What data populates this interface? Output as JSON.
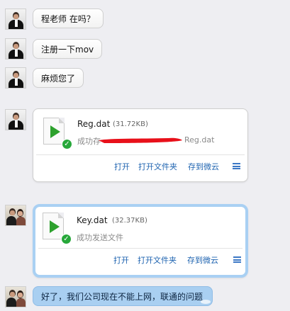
{
  "messages": [
    {
      "text": "程老师 在吗？"
    },
    {
      "text": "注册一下mov"
    },
    {
      "text": "麻烦您了"
    }
  ],
  "file_cards": [
    {
      "name": "Reg.dat",
      "size": "(31.72KB)",
      "status": "成功存",
      "status_tail": "Reg.dat",
      "actions": {
        "open": "打开",
        "open_folder": "打开文件夹",
        "save_cloud": "存到微云"
      }
    },
    {
      "name": "Key.dat",
      "size": "(32.37KB)",
      "status": "成功发送文件",
      "actions": {
        "open": "打开",
        "open_folder": "打开文件夹",
        "save_cloud": "存到微云"
      }
    }
  ],
  "reply": {
    "text": "好了，我们公司现在不能上网，联通的问题"
  },
  "colors": {
    "accent_link": "#1e63b0",
    "sent_bubble": "#a9cff1",
    "success_check": "#27a83a",
    "play_icon": "#2da12d",
    "redaction": "#e8101a"
  },
  "icons": [
    "avatar",
    "file-play-icon",
    "check-icon",
    "menu-icon"
  ]
}
